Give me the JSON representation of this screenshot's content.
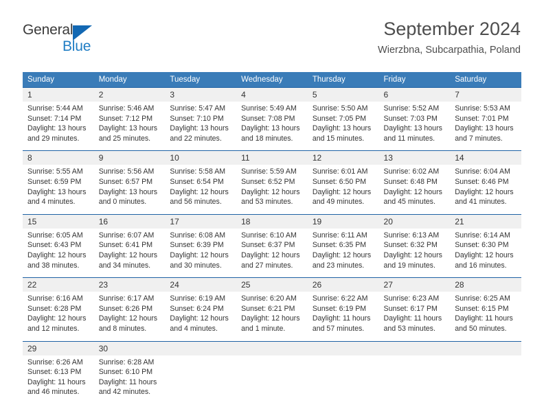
{
  "brand": {
    "name_part1": "General",
    "name_part2": "Blue",
    "triangle_icon": "blue-triangle-icon",
    "accent_color": "#1f7dc4",
    "triangle_color": "#1268b3"
  },
  "header": {
    "title": "September 2024",
    "subtitle": "Wierzbna, Subcarpathia, Poland"
  },
  "calendar": {
    "header_bg": "#3a7cb8",
    "header_text_color": "#ffffff",
    "daynum_bg": "#f0f0f0",
    "row_border_color": "#1d61a4",
    "weekdays": [
      "Sunday",
      "Monday",
      "Tuesday",
      "Wednesday",
      "Thursday",
      "Friday",
      "Saturday"
    ],
    "weeks": [
      [
        {
          "day": "1",
          "sunrise": "Sunrise: 5:44 AM",
          "sunset": "Sunset: 7:14 PM",
          "daylight": "Daylight: 13 hours and 29 minutes."
        },
        {
          "day": "2",
          "sunrise": "Sunrise: 5:46 AM",
          "sunset": "Sunset: 7:12 PM",
          "daylight": "Daylight: 13 hours and 25 minutes."
        },
        {
          "day": "3",
          "sunrise": "Sunrise: 5:47 AM",
          "sunset": "Sunset: 7:10 PM",
          "daylight": "Daylight: 13 hours and 22 minutes."
        },
        {
          "day": "4",
          "sunrise": "Sunrise: 5:49 AM",
          "sunset": "Sunset: 7:08 PM",
          "daylight": "Daylight: 13 hours and 18 minutes."
        },
        {
          "day": "5",
          "sunrise": "Sunrise: 5:50 AM",
          "sunset": "Sunset: 7:05 PM",
          "daylight": "Daylight: 13 hours and 15 minutes."
        },
        {
          "day": "6",
          "sunrise": "Sunrise: 5:52 AM",
          "sunset": "Sunset: 7:03 PM",
          "daylight": "Daylight: 13 hours and 11 minutes."
        },
        {
          "day": "7",
          "sunrise": "Sunrise: 5:53 AM",
          "sunset": "Sunset: 7:01 PM",
          "daylight": "Daylight: 13 hours and 7 minutes."
        }
      ],
      [
        {
          "day": "8",
          "sunrise": "Sunrise: 5:55 AM",
          "sunset": "Sunset: 6:59 PM",
          "daylight": "Daylight: 13 hours and 4 minutes."
        },
        {
          "day": "9",
          "sunrise": "Sunrise: 5:56 AM",
          "sunset": "Sunset: 6:57 PM",
          "daylight": "Daylight: 13 hours and 0 minutes."
        },
        {
          "day": "10",
          "sunrise": "Sunrise: 5:58 AM",
          "sunset": "Sunset: 6:54 PM",
          "daylight": "Daylight: 12 hours and 56 minutes."
        },
        {
          "day": "11",
          "sunrise": "Sunrise: 5:59 AM",
          "sunset": "Sunset: 6:52 PM",
          "daylight": "Daylight: 12 hours and 53 minutes."
        },
        {
          "day": "12",
          "sunrise": "Sunrise: 6:01 AM",
          "sunset": "Sunset: 6:50 PM",
          "daylight": "Daylight: 12 hours and 49 minutes."
        },
        {
          "day": "13",
          "sunrise": "Sunrise: 6:02 AM",
          "sunset": "Sunset: 6:48 PM",
          "daylight": "Daylight: 12 hours and 45 minutes."
        },
        {
          "day": "14",
          "sunrise": "Sunrise: 6:04 AM",
          "sunset": "Sunset: 6:46 PM",
          "daylight": "Daylight: 12 hours and 41 minutes."
        }
      ],
      [
        {
          "day": "15",
          "sunrise": "Sunrise: 6:05 AM",
          "sunset": "Sunset: 6:43 PM",
          "daylight": "Daylight: 12 hours and 38 minutes."
        },
        {
          "day": "16",
          "sunrise": "Sunrise: 6:07 AM",
          "sunset": "Sunset: 6:41 PM",
          "daylight": "Daylight: 12 hours and 34 minutes."
        },
        {
          "day": "17",
          "sunrise": "Sunrise: 6:08 AM",
          "sunset": "Sunset: 6:39 PM",
          "daylight": "Daylight: 12 hours and 30 minutes."
        },
        {
          "day": "18",
          "sunrise": "Sunrise: 6:10 AM",
          "sunset": "Sunset: 6:37 PM",
          "daylight": "Daylight: 12 hours and 27 minutes."
        },
        {
          "day": "19",
          "sunrise": "Sunrise: 6:11 AM",
          "sunset": "Sunset: 6:35 PM",
          "daylight": "Daylight: 12 hours and 23 minutes."
        },
        {
          "day": "20",
          "sunrise": "Sunrise: 6:13 AM",
          "sunset": "Sunset: 6:32 PM",
          "daylight": "Daylight: 12 hours and 19 minutes."
        },
        {
          "day": "21",
          "sunrise": "Sunrise: 6:14 AM",
          "sunset": "Sunset: 6:30 PM",
          "daylight": "Daylight: 12 hours and 16 minutes."
        }
      ],
      [
        {
          "day": "22",
          "sunrise": "Sunrise: 6:16 AM",
          "sunset": "Sunset: 6:28 PM",
          "daylight": "Daylight: 12 hours and 12 minutes."
        },
        {
          "day": "23",
          "sunrise": "Sunrise: 6:17 AM",
          "sunset": "Sunset: 6:26 PM",
          "daylight": "Daylight: 12 hours and 8 minutes."
        },
        {
          "day": "24",
          "sunrise": "Sunrise: 6:19 AM",
          "sunset": "Sunset: 6:24 PM",
          "daylight": "Daylight: 12 hours and 4 minutes."
        },
        {
          "day": "25",
          "sunrise": "Sunrise: 6:20 AM",
          "sunset": "Sunset: 6:21 PM",
          "daylight": "Daylight: 12 hours and 1 minute."
        },
        {
          "day": "26",
          "sunrise": "Sunrise: 6:22 AM",
          "sunset": "Sunset: 6:19 PM",
          "daylight": "Daylight: 11 hours and 57 minutes."
        },
        {
          "day": "27",
          "sunrise": "Sunrise: 6:23 AM",
          "sunset": "Sunset: 6:17 PM",
          "daylight": "Daylight: 11 hours and 53 minutes."
        },
        {
          "day": "28",
          "sunrise": "Sunrise: 6:25 AM",
          "sunset": "Sunset: 6:15 PM",
          "daylight": "Daylight: 11 hours and 50 minutes."
        }
      ],
      [
        {
          "day": "29",
          "sunrise": "Sunrise: 6:26 AM",
          "sunset": "Sunset: 6:13 PM",
          "daylight": "Daylight: 11 hours and 46 minutes."
        },
        {
          "day": "30",
          "sunrise": "Sunrise: 6:28 AM",
          "sunset": "Sunset: 6:10 PM",
          "daylight": "Daylight: 11 hours and 42 minutes."
        },
        {
          "day": "",
          "sunrise": "",
          "sunset": "",
          "daylight": ""
        },
        {
          "day": "",
          "sunrise": "",
          "sunset": "",
          "daylight": ""
        },
        {
          "day": "",
          "sunrise": "",
          "sunset": "",
          "daylight": ""
        },
        {
          "day": "",
          "sunrise": "",
          "sunset": "",
          "daylight": ""
        },
        {
          "day": "",
          "sunrise": "",
          "sunset": "",
          "daylight": ""
        }
      ]
    ]
  }
}
